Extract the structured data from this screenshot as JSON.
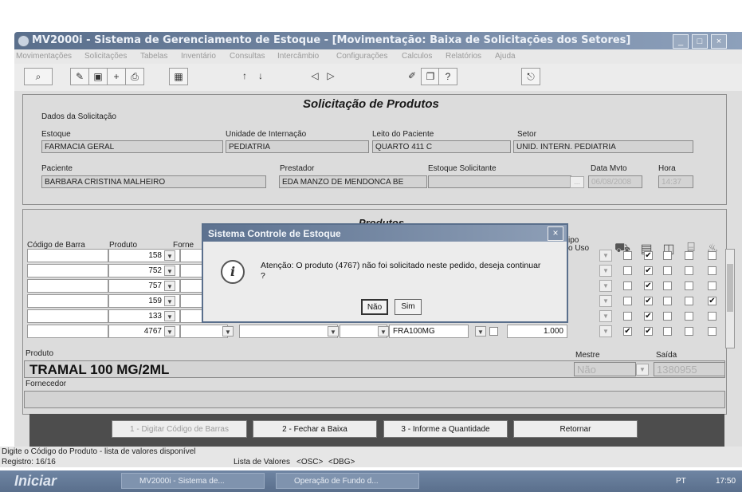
{
  "window": {
    "title": "MV2000i - Sistema de Gerenciamento de Estoque - [Movimentação: Baixa de Solicitações dos Setores]"
  },
  "menu": [
    "Movimentações",
    "Solicitações",
    "Tabelas",
    "Inventário",
    "Consultas",
    "Intercâmbio",
    "Configurações",
    "Calculos",
    "Relatórios",
    "Ajuda"
  ],
  "form": {
    "title": "Solicitação de Produtos",
    "group_label": "Dados da Solicitação",
    "estoque_label": "Estoque",
    "estoque_value": "FARMACIA GERAL",
    "unidade_label": "Unidade de Internação",
    "unidade_value": "PEDIATRIA",
    "leito_label": "Leito do Paciente",
    "leito_value": "QUARTO 411 C",
    "setor_label": "Setor",
    "setor_value": "UNID. INTERN. PEDIATRIA",
    "paciente_label": "Paciente",
    "paciente_value": "BARBARA CRISTINA MALHEIRO",
    "prestador_label": "Prestador",
    "prestador_value": "EDA MANZO DE MENDONCA BE",
    "estoque_sol_label": "Estoque Solicitante",
    "estoque_sol_value": "",
    "data_label": "Data Mvto",
    "data_value": "06/08/2008",
    "hora_label": "Hora",
    "hora_value": "14:37"
  },
  "products": {
    "section_title": "Produtos",
    "col_barcode": "Código de Barra",
    "col_produto": "Produto",
    "col_fornecedor": "Forne",
    "col_tipo": "ipo",
    "col_uso": "o Uso",
    "rows": [
      {
        "produto": "158",
        "lote": "",
        "qtd": ""
      },
      {
        "produto": "752",
        "lote": "",
        "qtd": ""
      },
      {
        "produto": "757",
        "lote": "",
        "qtd": ""
      },
      {
        "produto": "159",
        "lote": "",
        "qtd": ""
      },
      {
        "produto": "133",
        "lote": "",
        "qtd": ""
      },
      {
        "produto": "4767",
        "lote": "FRA100MG",
        "qtd": "1.000"
      }
    ],
    "produto_label": "Produto",
    "produto_name": "TRAMAL 100 MG/2ML",
    "fornecedor_label": "Fornecedor",
    "fornecedor_value": "",
    "mestre_label": "Mestre",
    "mestre_value": "Não",
    "saida_label": "Saída",
    "saida_value": "1380955"
  },
  "actions": {
    "btn1": "1 - Digitar Código de Barras",
    "btn2": "2 - Fechar a Baixa",
    "btn3": "3 - Informe a Quantidade",
    "btn4": "Retornar"
  },
  "status": {
    "hint": "Digite o Código do Produto - lista de valores disponível",
    "registro": "Registro: 16/16",
    "lista": "Lista de Valores",
    "osc": "<OSC>",
    "dbg": "<DBG>"
  },
  "taskbar": {
    "start": "Iniciar",
    "task1": "MV2000i - Sistema de...",
    "task2": "Operação de Fundo d...",
    "lang": "PT",
    "time": "17:50"
  },
  "dialog": {
    "title": "Sistema Controle de Estoque",
    "message": "Atenção: O produto (4767) não foi solicitado neste pedido, deseja continuar ?",
    "no_label": "Não",
    "yes_label": "Sim"
  },
  "icons": {
    "info": "info-icon",
    "close": "close-icon"
  }
}
